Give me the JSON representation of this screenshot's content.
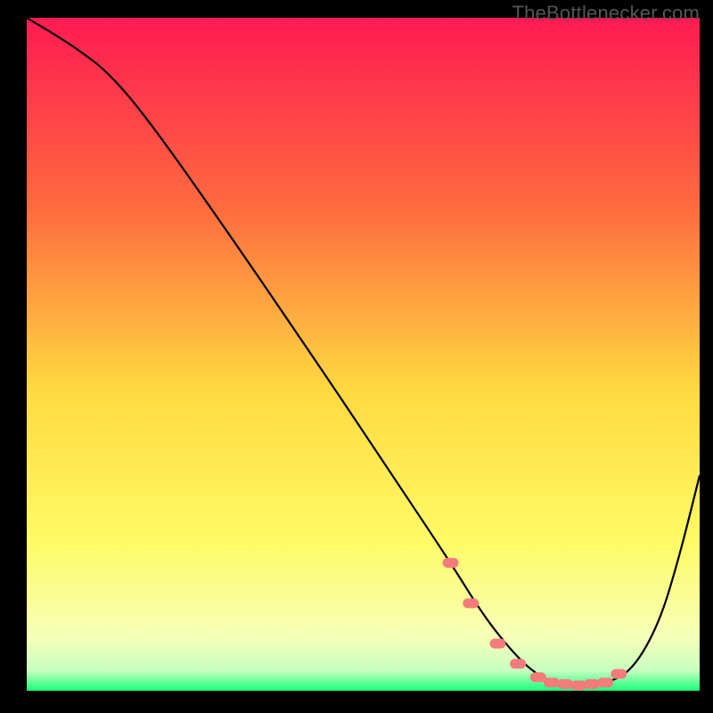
{
  "watermark": "TheBottlenecker.com",
  "colors": {
    "top": "#ff1a52",
    "mid_upper": "#ff6a3f",
    "mid": "#ffd840",
    "mid_lower": "#fffb66",
    "near_bottom": "#f6ffb8",
    "bottom_green": "#19ff7a",
    "stroke": "#000000",
    "marker": "#f47b7b"
  },
  "chart_data": {
    "type": "line",
    "title": "",
    "xlabel": "",
    "ylabel": "",
    "xlim": [
      0,
      100
    ],
    "ylim": [
      0,
      100
    ],
    "grid": false,
    "legend": false,
    "series": [
      {
        "name": "bottleneck-curve",
        "x": [
          0,
          5,
          8,
          12,
          18,
          30,
          45,
          55,
          63,
          68,
          72,
          75,
          78,
          82,
          86,
          90,
          94,
          97,
          100
        ],
        "y": [
          100,
          97,
          95,
          92,
          85,
          68,
          46,
          31,
          19,
          11,
          6,
          3,
          1.2,
          0.8,
          1.0,
          3,
          10,
          20,
          32
        ]
      }
    ],
    "markers": {
      "name": "highlighted-points",
      "x": [
        63,
        66,
        70,
        73,
        76,
        78,
        80,
        82,
        84,
        86,
        88
      ],
      "y": [
        19,
        13,
        7,
        4,
        2,
        1.2,
        1.0,
        0.8,
        1.0,
        1.2,
        2.5
      ]
    }
  }
}
